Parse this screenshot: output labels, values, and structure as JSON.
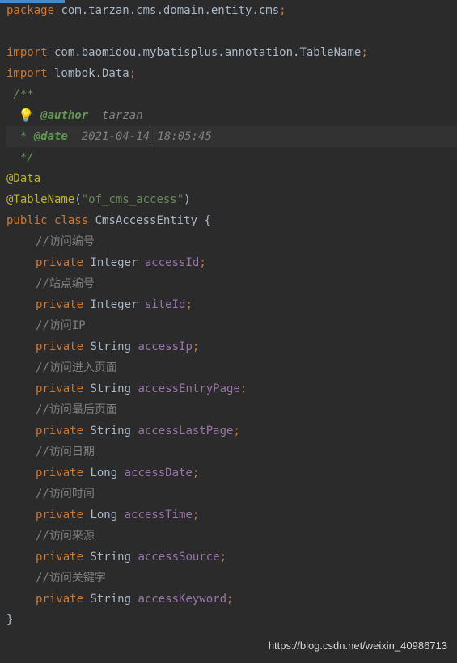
{
  "tab_indicator": true,
  "lines": {
    "l1": {
      "kw": "package",
      "pkg": " com.tarzan.cms.domain.entity.cms",
      "semi": ";"
    },
    "l3": {
      "kw": "import",
      "pkg": " com.baomidou.mybatisplus.annotation.TableName",
      "semi": ";"
    },
    "l4": {
      "kw": "import",
      "pkg": " lombok.Data",
      "semi": ";"
    },
    "l5": {
      "doc": " /**"
    },
    "l6": {
      "bulb": "💡",
      "pre": "* ",
      "tag": "@author",
      "val": "  tarzan"
    },
    "l7": {
      "pre": "  * ",
      "tag": "@date",
      "val1": "  2021-04-14",
      "val2": " 18:05:45"
    },
    "l8": {
      "doc": "  */"
    },
    "l9": {
      "ann": "@Data"
    },
    "l10": {
      "ann": "@TableName",
      "lp": "(",
      "str": "\"of_cms_access\"",
      "rp": ")"
    },
    "l11": {
      "kw1": "public ",
      "kw2": "class ",
      "cls": "CmsAccessEntity ",
      "brace": "{"
    },
    "c1": "//访问编号",
    "f1": {
      "kw": "private ",
      "type": "Integer ",
      "name": "accessId",
      "semi": ";"
    },
    "c2": "//站点编号",
    "f2": {
      "kw": "private ",
      "type": "Integer ",
      "name": "siteId",
      "semi": ";"
    },
    "c3": "//访问IP",
    "f3": {
      "kw": "private ",
      "type": "String ",
      "name": "accessIp",
      "semi": ";"
    },
    "c4": "//访问进入页面",
    "f4": {
      "kw": "private ",
      "type": "String ",
      "name": "accessEntryPage",
      "semi": ";"
    },
    "c5": "//访问最后页面",
    "f5": {
      "kw": "private ",
      "type": "String ",
      "name": "accessLastPage",
      "semi": ";"
    },
    "c6": "//访问日期",
    "f6": {
      "kw": "private ",
      "type": "Long ",
      "name": "accessDate",
      "semi": ";"
    },
    "c7": "//访问时间",
    "f7": {
      "kw": "private ",
      "type": "Long ",
      "name": "accessTime",
      "semi": ";"
    },
    "c8": "//访问来源",
    "f8": {
      "kw": "private ",
      "type": "String ",
      "name": "accessSource",
      "semi": ";"
    },
    "c9": "//访问关键字",
    "f9": {
      "kw": "private ",
      "type": "String ",
      "name": "accessKeyword",
      "semi": ";"
    },
    "close": "}"
  },
  "watermark": "https://blog.csdn.net/weixin_40986713"
}
